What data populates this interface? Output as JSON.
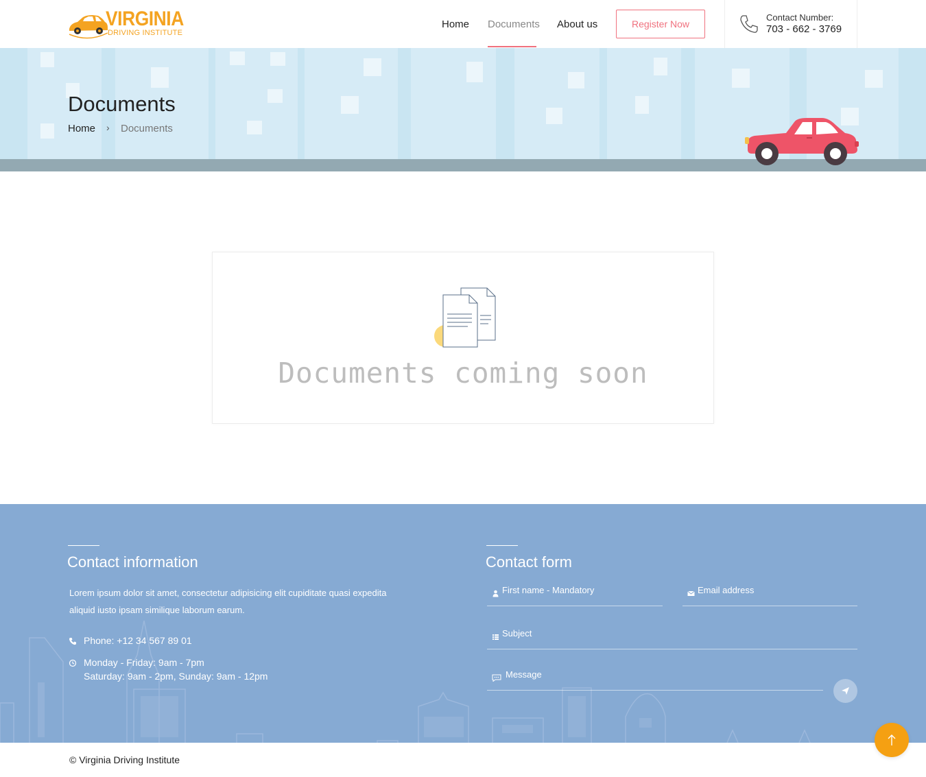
{
  "logo": {
    "line1": "VIRGINIA",
    "line2": "DRIVING INSTITUTE",
    "icon": "car-logo-icon",
    "color": "#f4a321"
  },
  "nav": {
    "items": [
      {
        "label": "Home"
      },
      {
        "label": "Documents",
        "active": true
      },
      {
        "label": "About us"
      }
    ],
    "register_label": "Register Now",
    "accent": "#f0717e"
  },
  "contact": {
    "label": "Contact Number:",
    "number": "703 - 662 - 3769",
    "icon": "phone-icon"
  },
  "banner": {
    "title": "Documents",
    "breadcrumb": {
      "home": "Home",
      "separator": "›",
      "current": "Documents"
    }
  },
  "main": {
    "message": "Documents coming soon",
    "icon": "documents-icon"
  },
  "footer": {
    "contact_info": {
      "heading": "Contact information",
      "text": "Lorem ipsum dolor sit amet, consectetur adipisicing elit cupiditate quasi expedita aliquid iusto ipsam similique laborum earum.",
      "phone": "Phone: +12 34 567 89 01",
      "hours_line1": "Monday - Friday: 9am - 7pm",
      "hours_line2": "Saturday: 9am - 2pm, Sunday: 9am - 12pm"
    },
    "contact_form": {
      "heading": "Contact form",
      "first_name_placeholder": "First name - Mandatory",
      "email_placeholder": "Email address",
      "subject_placeholder": "Subject",
      "message_placeholder": "Message"
    },
    "background": "#86aad3"
  },
  "copyright": "© Virginia Driving Institute",
  "back_to_top": {
    "icon": "arrow-up-icon",
    "color": "#f5a012"
  }
}
